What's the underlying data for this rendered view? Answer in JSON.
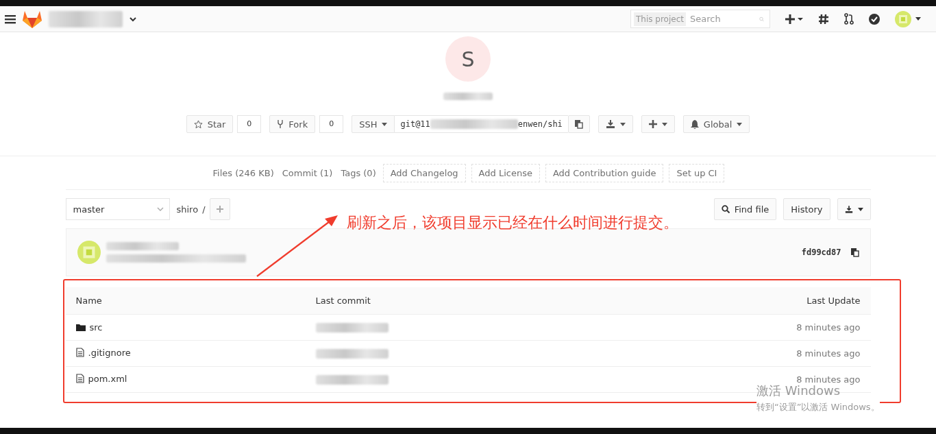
{
  "header": {
    "search_scope": "This project",
    "search_placeholder": "Search"
  },
  "project": {
    "avatar_letter": "S",
    "star_label": "Star",
    "star_count": "0",
    "fork_label": "Fork",
    "fork_count": "0",
    "protocol": "SSH",
    "url_start": "git@11",
    "url_end": "enwen/shi",
    "notification": "Global"
  },
  "nav_links": [
    {
      "label": "Files (246 KB)",
      "kind": "link"
    },
    {
      "label": "Commit (1)",
      "kind": "link"
    },
    {
      "label": "Tags (0)",
      "kind": "link"
    },
    {
      "label": "Add Changelog",
      "kind": "dashed"
    },
    {
      "label": "Add License",
      "kind": "dashed"
    },
    {
      "label": "Add Contribution guide",
      "kind": "dashed"
    },
    {
      "label": "Set up CI",
      "kind": "dashed"
    }
  ],
  "toolbar": {
    "branch": "master",
    "path": "shiro",
    "separator": "/",
    "find_file": "Find file",
    "history": "History"
  },
  "commit": {
    "sha": "fd99cd87"
  },
  "table": {
    "columns": [
      "Name",
      "Last commit",
      "Last Update"
    ],
    "rows": [
      {
        "name": "src",
        "kind": "folder",
        "updated": "8 minutes ago"
      },
      {
        "name": ".gitignore",
        "kind": "file",
        "updated": "8 minutes ago"
      },
      {
        "name": "pom.xml",
        "kind": "file",
        "updated": "8 minutes ago"
      }
    ]
  },
  "annotation": {
    "text": "刷新之后，该项目显示已经在什么时间进行提交。"
  },
  "windows_notice": {
    "title": "激活 Windows",
    "hint": "转到“设置”以激活 Windows。"
  }
}
